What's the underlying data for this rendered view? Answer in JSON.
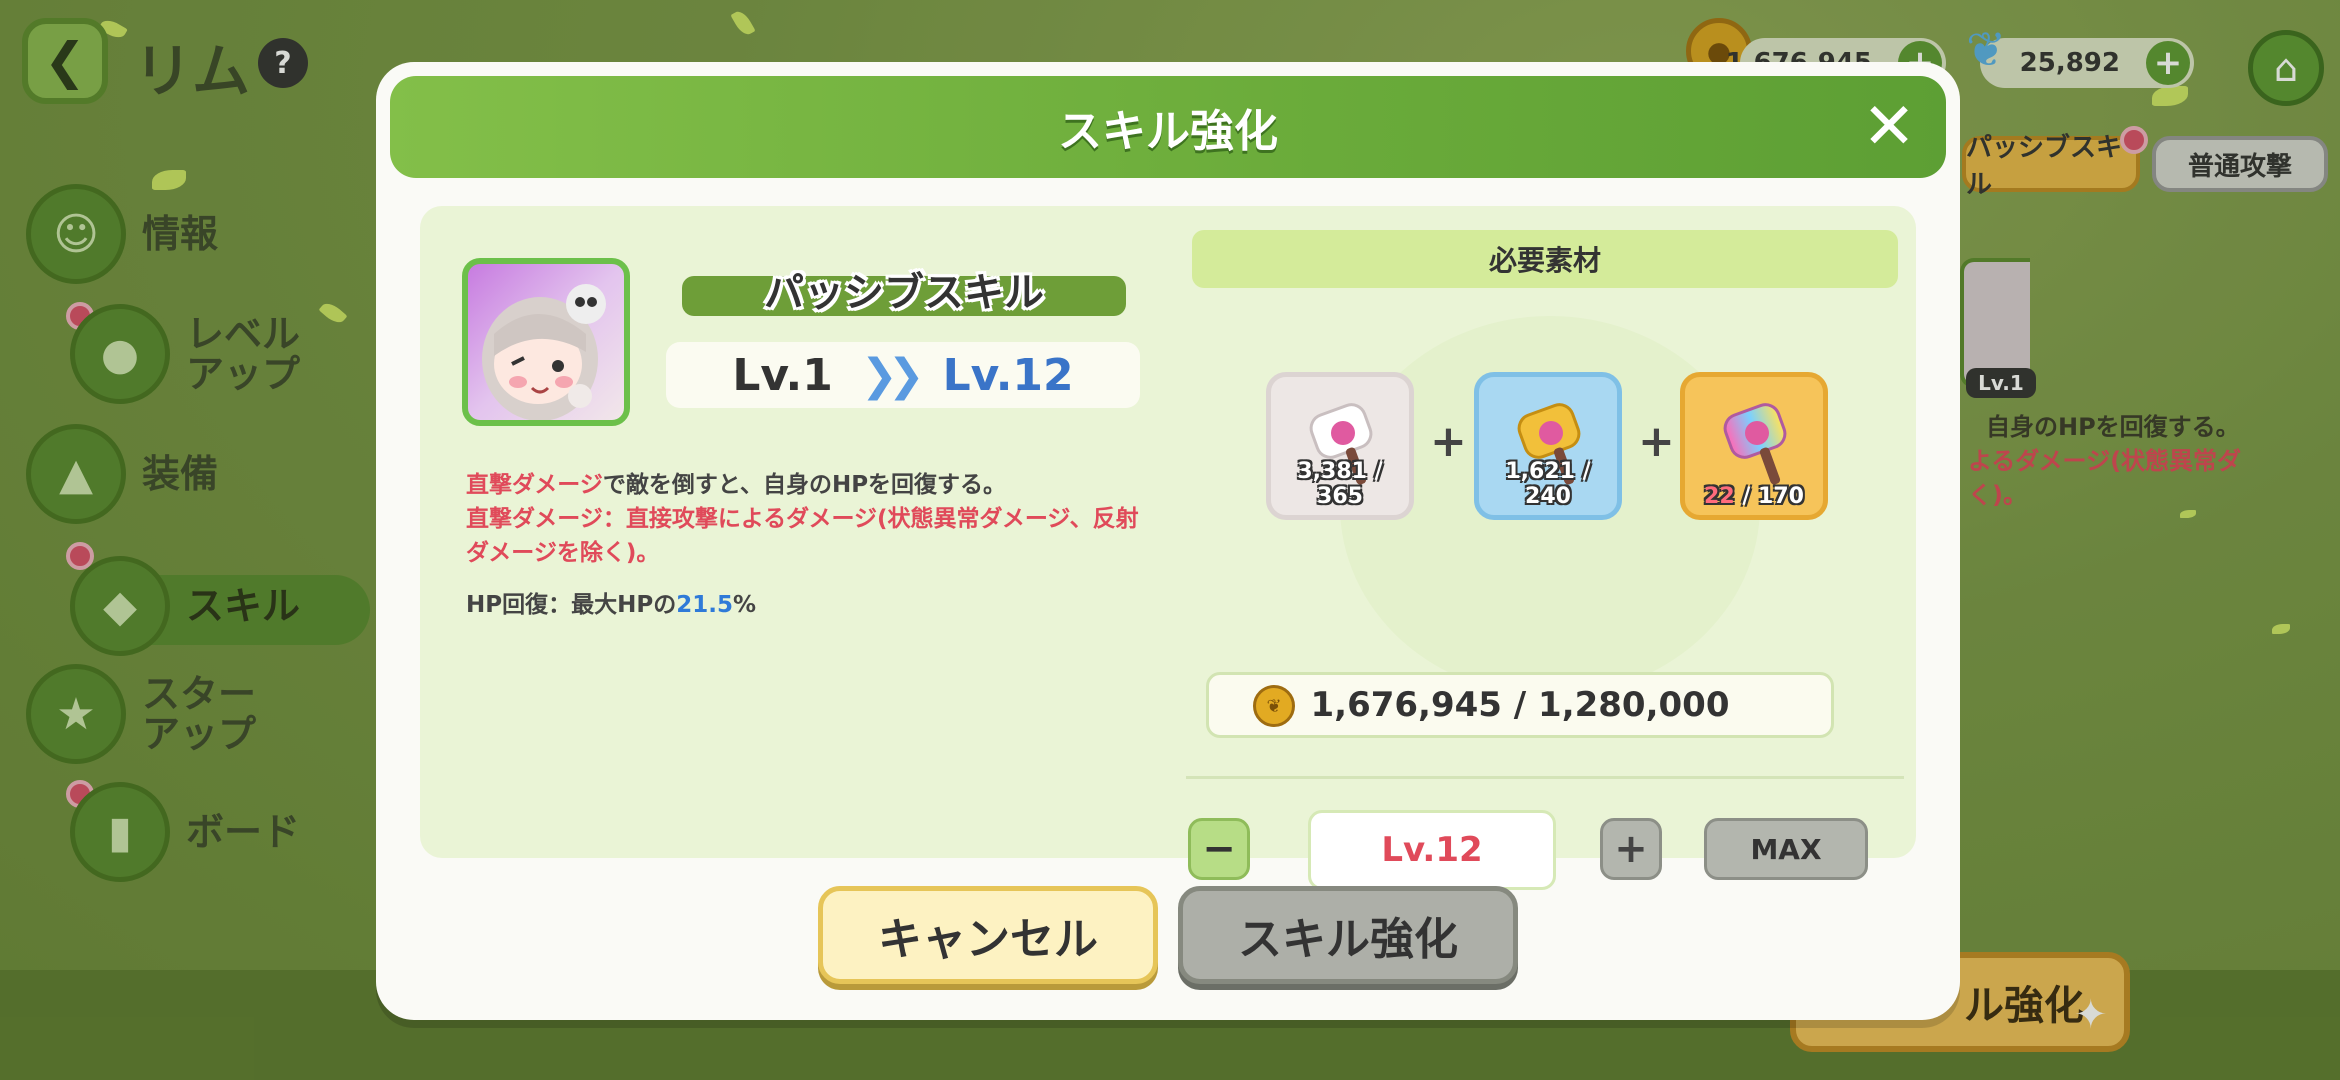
{
  "background": {
    "character_name": "リム",
    "help_icon": "?",
    "currencies": [
      {
        "icon": "coin-icon",
        "value": "1,676,945"
      },
      {
        "icon": "butterfly-icon",
        "value": "25,892"
      }
    ],
    "side_menu": [
      {
        "label": "情報"
      },
      {
        "label": "レベル\nアップ"
      },
      {
        "label": "装備"
      },
      {
        "label": "スキル"
      },
      {
        "label": "スター\nアップ"
      },
      {
        "label": "ボード"
      }
    ],
    "tabs": {
      "passive": "パッシブスキル",
      "normal": "普通攻撃"
    },
    "portrait_level": "Lv.1",
    "desc_line1": "自身のHPを回復する。",
    "desc_line2": "よるダメージ(状態異常ダ",
    "desc_line3": "く)。",
    "enhance_button": "ル強化"
  },
  "modal": {
    "title": "スキル強化",
    "skill_name": "パッシブスキル",
    "level_from": "Lv.1",
    "level_arrow": "»",
    "level_to": "Lv.12",
    "description": {
      "line1_red": "直撃ダメージ",
      "line1_rest": "で敵を倒すと、自身のHPを回復する。",
      "line2": "直撃ダメージ：直接攻撃によるダメージ(状態異常ダメージ、反射ダメージを除く)。",
      "hp_prefix": "HP回復：最大HPの",
      "hp_value": "21.5",
      "hp_suffix": "%"
    },
    "required_header": "必要素材",
    "materials": [
      {
        "icon": "white-hammer-icon",
        "owned": "3,381",
        "required": "365"
      },
      {
        "icon": "blue-hammer-icon",
        "owned": "1,621",
        "required": "240"
      },
      {
        "icon": "rainbow-hammer-icon",
        "owned": "22",
        "required": "170"
      }
    ],
    "plus_symbol": "+",
    "coin_cost": "1,676,945 / 1,280,000",
    "minus_label": "−",
    "target_level": "Lv.12",
    "plus_label": "+",
    "max_label": "MAX",
    "cancel_label": "キャンセル",
    "confirm_label": "スキル強化",
    "close_label": "✕"
  },
  "colors": {
    "accent_green": "#6aab3a",
    "warning_red": "#e04a5a",
    "value_blue": "#2f7ad8"
  }
}
